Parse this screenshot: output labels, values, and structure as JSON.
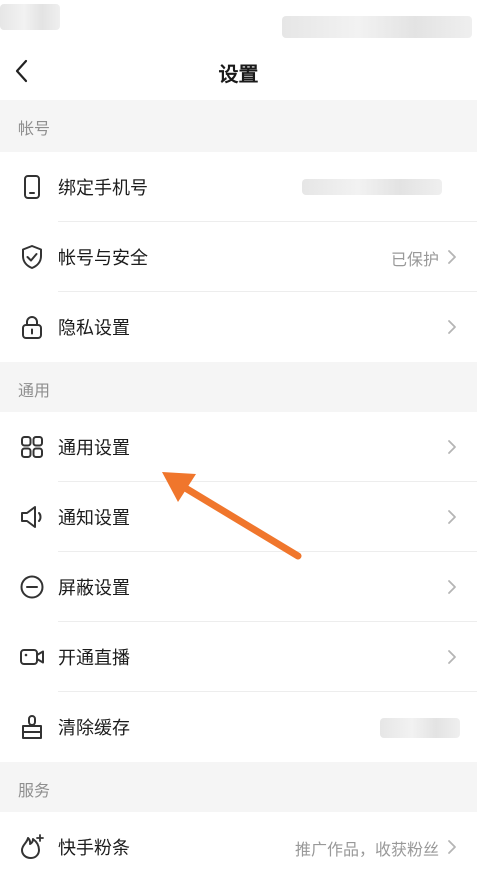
{
  "header": {
    "title": "设置"
  },
  "sections": [
    {
      "title": "帐号"
    },
    {
      "title": "通用"
    },
    {
      "title": "服务"
    }
  ],
  "rows": [
    {
      "icon": "phone-icon",
      "label": "绑定手机号",
      "value": ""
    },
    {
      "icon": "shield-icon",
      "label": "帐号与安全",
      "value": "已保护"
    },
    {
      "icon": "lock-icon",
      "label": "隐私设置",
      "value": ""
    },
    {
      "icon": "grid-icon",
      "label": "通用设置",
      "value": ""
    },
    {
      "icon": "speaker-icon",
      "label": "通知设置",
      "value": ""
    },
    {
      "icon": "block-icon",
      "label": "屏蔽设置",
      "value": ""
    },
    {
      "icon": "video-icon",
      "label": "开通直播",
      "value": ""
    },
    {
      "icon": "brush-icon",
      "label": "清除缓存",
      "value": ""
    },
    {
      "icon": "flame-plus-icon",
      "label": "快手粉条",
      "value": "推广作品，收获粉丝"
    }
  ],
  "colors": {
    "annotation_arrow": "#f0762c",
    "background": "#f5f5f5"
  }
}
